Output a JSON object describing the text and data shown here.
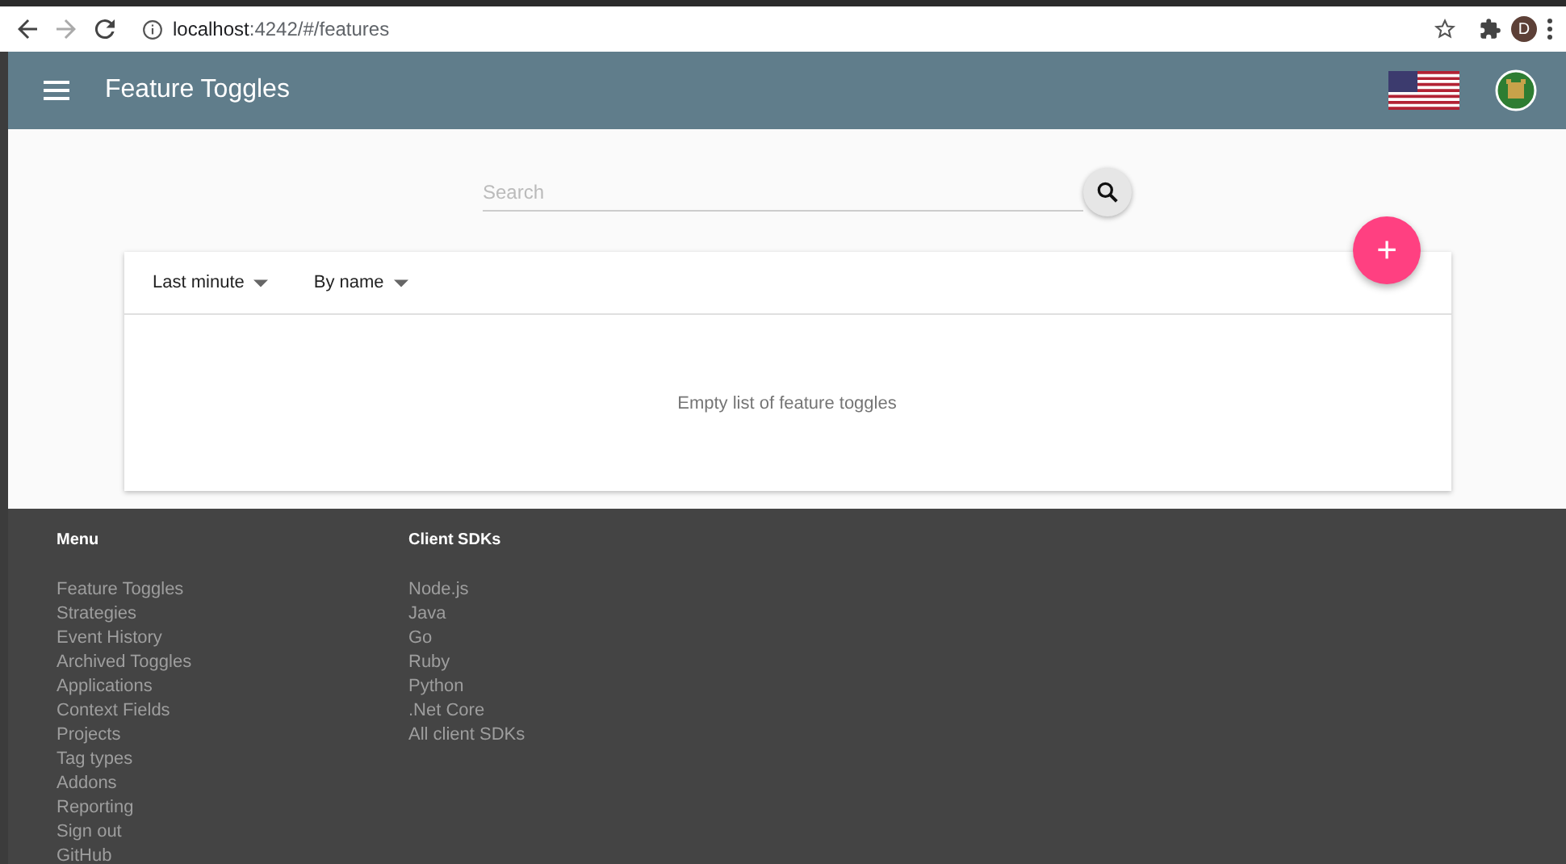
{
  "browser": {
    "url_host": "localhost",
    "url_path": ":4242/#/features",
    "profile": "D"
  },
  "app_bar": {
    "title": "Feature Toggles"
  },
  "search": {
    "placeholder": "Search"
  },
  "filters": [
    {
      "label": "Last minute"
    },
    {
      "label": "By name"
    }
  ],
  "add_button": {
    "label": "+"
  },
  "empty_message": "Empty list of feature toggles",
  "footer": {
    "columns": [
      {
        "heading": "Menu",
        "links": [
          "Feature Toggles",
          "Strategies",
          "Event History",
          "Archived Toggles",
          "Applications",
          "Context Fields",
          "Projects",
          "Tag types",
          "Addons",
          "Reporting",
          "Sign out",
          "GitHub"
        ]
      },
      {
        "heading": "Client SDKs",
        "links": [
          "Node.js",
          "Java",
          "Go",
          "Ruby",
          "Python",
          ".Net Core",
          "All client SDKs"
        ]
      }
    ]
  }
}
